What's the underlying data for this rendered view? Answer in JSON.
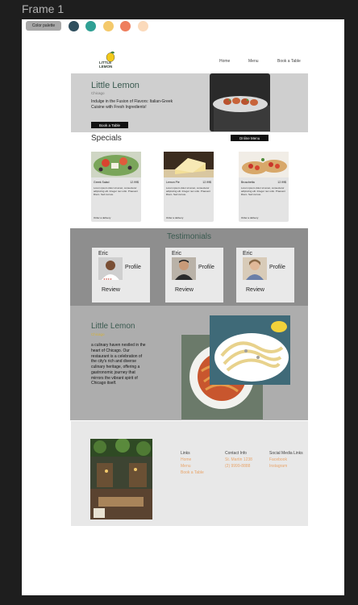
{
  "canvas": {
    "frame_label": "Frame 1"
  },
  "palette": {
    "button_label": "Color palette",
    "swatches": [
      {
        "label": "#2F4F5E",
        "color": "#2f4f5e"
      },
      {
        "label": "#2FA094",
        "color": "#2fa094"
      },
      {
        "label": "#F4C96B",
        "color": "#f4c96b"
      },
      {
        "label": "#EE7E5E",
        "color": "#ee7e5e"
      },
      {
        "label": "#FBDABB",
        "color": "#fbdabb"
      }
    ]
  },
  "header": {
    "logo_text": "LITTLE LEMON",
    "nav": [
      "Home",
      "Menu",
      "Book a Table"
    ]
  },
  "hero": {
    "title": "Little Lemon",
    "subtitle": "Chicago",
    "description": "Indulge in the Fusion of Flavors: Italian-Greek Cuisine with Fresh Ingredients!",
    "button": "Book a Table"
  },
  "specials": {
    "title": "Specials",
    "online_menu_button": "Online Menu",
    "items": [
      {
        "name": "Greek Salad",
        "price": "12.99$",
        "description": "Lorem ipsum dolor sit amet, consectetur adipiscing elit. Integer nec odio. Praesent libero. Sed cursus.",
        "order": "Order a delivery"
      },
      {
        "name": "Lemon Pie",
        "price": "12.99$",
        "description": "Lorem ipsum dolor sit amet, consectetur adipiscing elit. Integer nec odio. Praesent libero. Sed cursus.",
        "order": "Order a delivery"
      },
      {
        "name": "Bruschetta",
        "price": "12.99$",
        "description": "Lorem ipsum dolor sit amet, consectetur adipiscing elit. Integer nec odio. Praesent libero. Sed cursus.",
        "order": "Order a delivery"
      }
    ]
  },
  "testimonials": {
    "title": "Testimonials",
    "items": [
      {
        "name": "Eric",
        "profile": "Profile",
        "rating": "★★★★",
        "review": "Review"
      },
      {
        "name": "Eric",
        "profile": "Profile",
        "review": "Review"
      },
      {
        "name": "Eric",
        "profile": "Profile",
        "review": "Review"
      }
    ]
  },
  "about": {
    "title": "Little Lemon",
    "subtitle": "Chicago",
    "description": "a culinary haven nestled in the heart of Chicago. Our restaurant is a celebration of the city's rich and diverse culinary heritage, offering a gastronomic journey that mirrors the vibrant spirit of Chicago itself."
  },
  "footer": {
    "links": {
      "heading": "Links",
      "items": [
        "Home",
        "Menu",
        "Book a Table"
      ]
    },
    "contact": {
      "heading": "Contact Info",
      "items": [
        "St. Martin 1238",
        "(2) 9999-8888"
      ]
    },
    "social": {
      "heading": "Social Media Links",
      "items": [
        "Facebook",
        "Instagram"
      ]
    }
  }
}
